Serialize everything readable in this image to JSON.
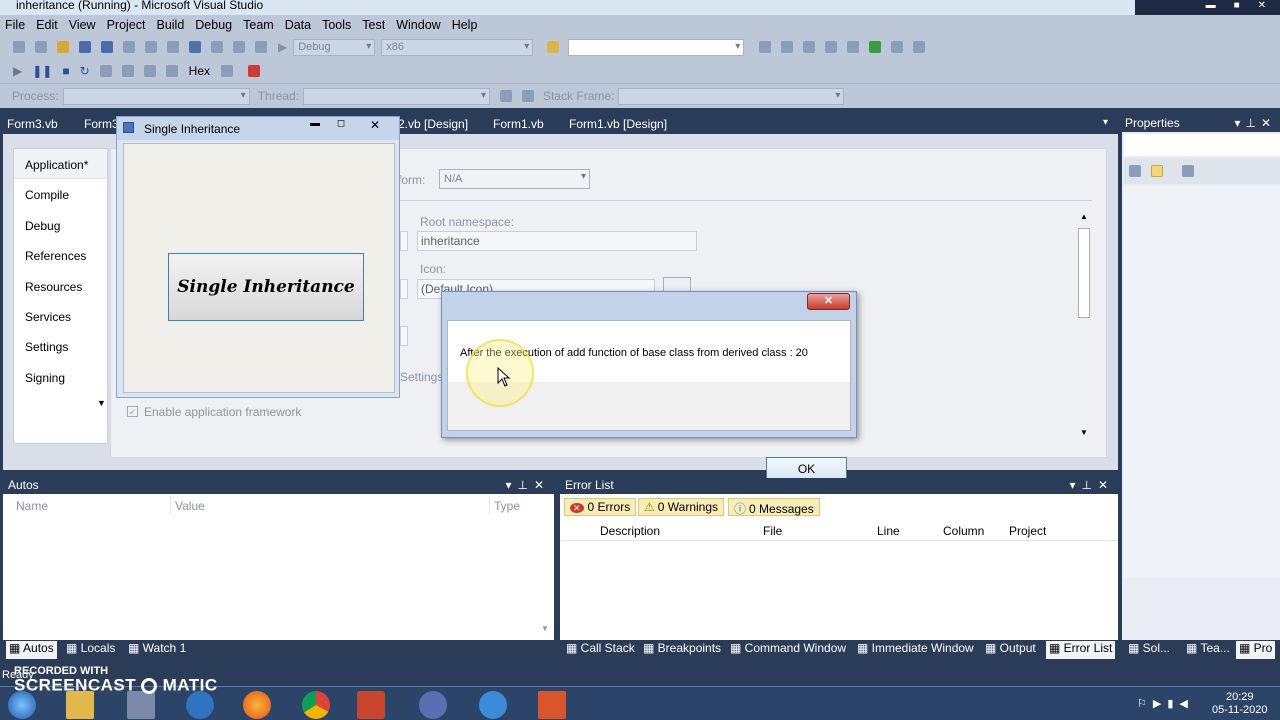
{
  "window": {
    "title": "inheritance (Running) - Microsoft Visual Studio"
  },
  "menu": [
    "File",
    "Edit",
    "View",
    "Project",
    "Build",
    "Debug",
    "Team",
    "Data",
    "Tools",
    "Test",
    "Window",
    "Help"
  ],
  "toolbar": {
    "config": "Debug",
    "platform": "x86",
    "hex": "Hex",
    "process_label": "Process:",
    "thread_label": "Thread:",
    "stack_label": "Stack Frame:"
  },
  "doc_tabs": [
    "Form3.vb",
    "Form3",
    "2.vb [Design]",
    "Form1.vb",
    "Form1.vb [Design]"
  ],
  "properties": {
    "title": "Properties"
  },
  "project_nav": [
    "Application*",
    "Compile",
    "Debug",
    "References",
    "Resources",
    "Services",
    "Settings",
    "Signing"
  ],
  "app_page": {
    "target_form_label": "form:",
    "target_form": "N/A",
    "root_ns_label": "Root namespace:",
    "root_ns": "inheritance",
    "icon_label": "Icon:",
    "icon_value": "(Default Icon)",
    "settings_partial": "Settings",
    "enable_framework": "Enable application framework"
  },
  "app_window": {
    "title": "Single Inheritance",
    "button": "Single Inheritance"
  },
  "msgbox": {
    "message": "After the execution of add function of base class from derived class : 20",
    "ok": "OK"
  },
  "autos": {
    "title": "Autos",
    "cols": [
      "Name",
      "Value",
      "Type"
    ]
  },
  "error_list": {
    "title": "Error List",
    "errors": "0 Errors",
    "warnings": "0 Warnings",
    "messages": "0 Messages",
    "cols": [
      "Description",
      "File",
      "Line",
      "Column",
      "Project"
    ]
  },
  "bottom_tabs_left": [
    "Autos",
    "Locals",
    "Watch 1"
  ],
  "bottom_tabs_right": [
    "Call Stack",
    "Breakpoints",
    "Command Window",
    "Immediate Window",
    "Output",
    "Error List",
    "Sol...",
    "Tea...",
    "Pro"
  ],
  "status": "Ready",
  "watermark": {
    "line1": "RECORDED WITH",
    "line2": "SCREENCAST",
    "line3": "MATIC"
  },
  "clock": {
    "time": "20:29",
    "date": "05-11-2020"
  }
}
